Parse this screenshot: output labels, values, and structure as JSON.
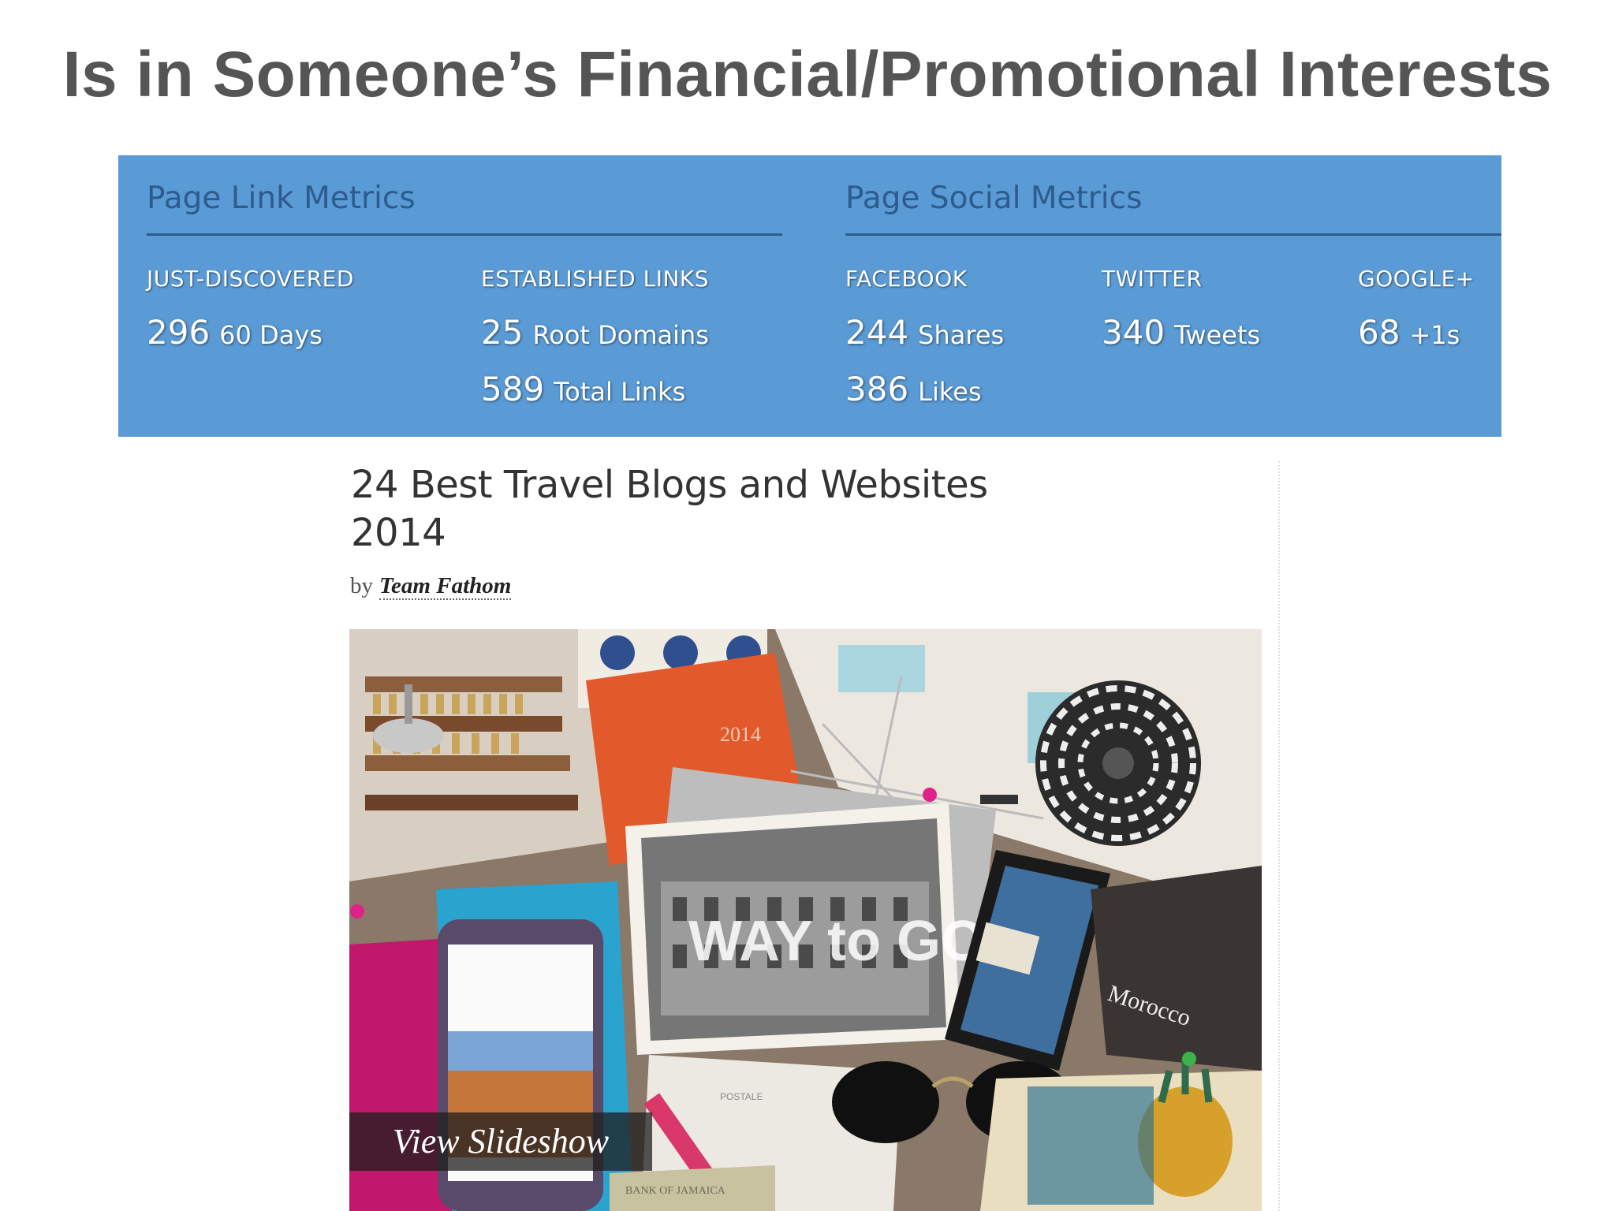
{
  "slide": {
    "title": "Is in Someone’s Financial/Promotional Interests"
  },
  "link_metrics": {
    "heading": "Page Link Metrics",
    "columns": [
      {
        "label": "JUST-DISCOVERED",
        "rows": [
          {
            "value": "296",
            "unit": "60 Days"
          }
        ]
      },
      {
        "label": "ESTABLISHED LINKS",
        "rows": [
          {
            "value": "25",
            "unit": "Root Domains"
          },
          {
            "value": "589",
            "unit": "Total Links"
          }
        ]
      }
    ]
  },
  "social_metrics": {
    "heading": "Page Social Metrics",
    "columns": [
      {
        "label": "FACEBOOK",
        "rows": [
          {
            "value": "244",
            "unit": "Shares"
          },
          {
            "value": "386",
            "unit": "Likes"
          }
        ]
      },
      {
        "label": "TWITTER",
        "rows": [
          {
            "value": "340",
            "unit": "Tweets"
          }
        ]
      },
      {
        "label": "GOOGLE+",
        "rows": [
          {
            "value": "68",
            "unit": "+1s"
          }
        ]
      }
    ]
  },
  "article": {
    "title": "24 Best Travel Blogs and Websites 2014",
    "byline_prefix": "by",
    "author": "Team Fathom",
    "image": {
      "notebook_year": "2014",
      "postcard_text": "WAY to GO",
      "map_label": "Morocco",
      "postale_text": "POSTALE",
      "banknote_text": "BANK OF JAMAICA",
      "view_slideshow_label": "View Slideshow"
    }
  },
  "colors": {
    "panel_blue": "#5b9bd5",
    "heading_dark_blue": "#2c5c8e",
    "title_gray": "#555555"
  }
}
